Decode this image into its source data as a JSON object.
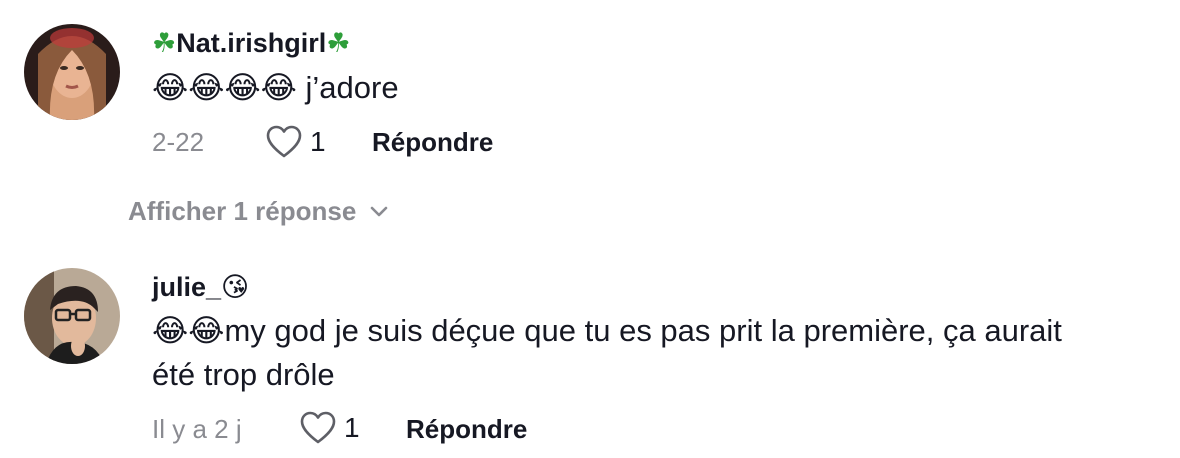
{
  "comments": [
    {
      "username": "Nat.irishgirl",
      "username_prefix_emoji": "☘",
      "username_suffix_emoji": "☘",
      "text_emojis": "😂😂😂😂",
      "text": " j’adore",
      "date": "2-22",
      "like_count": "1",
      "reply_label": "Répondre",
      "view_replies_label": "Afficher 1 réponse"
    },
    {
      "username": "julie_",
      "username_suffix_emoji": "😘",
      "text_emojis": "😂😂",
      "text_line1": "my god je suis déçue que tu es pas prit la première, ça aurait",
      "text_line2": "été trop drôle",
      "date": "Il y a 2 j",
      "like_count": "1",
      "reply_label": "Répondre"
    }
  ],
  "icons": {
    "like": "heart-outline-icon",
    "expand": "chevron-down-icon"
  },
  "colors": {
    "text_primary": "#161823",
    "text_secondary": "#8a8b91",
    "clover": "#2e9e3a"
  }
}
